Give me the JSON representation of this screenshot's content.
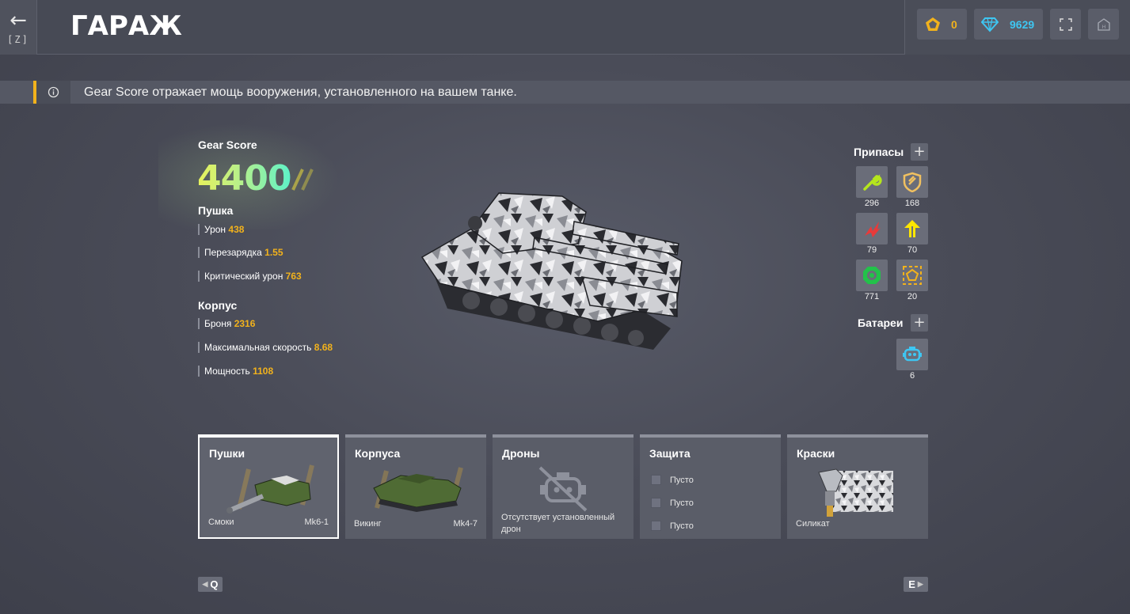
{
  "header": {
    "back_arrow": "←",
    "back_key": "[Z]",
    "title": "ГАРАЖ",
    "gold_crystals": "0",
    "crystals": "9629",
    "icons": [
      "back-arrow-icon",
      "pentagon-crystal-icon",
      "diamond-icon",
      "fullscreen-icon",
      "home-icon"
    ]
  },
  "info": {
    "icon": "info-icon",
    "text": "Gear Score отражает мощь вооружения, установленного на вашем танке."
  },
  "gear_score": {
    "label": "Gear Score",
    "value": "4400"
  },
  "turret": {
    "title": "Пушка",
    "stats": [
      {
        "label": "Урон",
        "value": "438"
      },
      {
        "label": "Перезарядка",
        "value": "1.55"
      },
      {
        "label": "Критический урон",
        "value": "763"
      }
    ]
  },
  "hull": {
    "title": "Корпус",
    "stats": [
      {
        "label": "Броня",
        "value": "2316"
      },
      {
        "label": "Максимальная скорость",
        "value": "8.68"
      },
      {
        "label": "Мощность",
        "value": "1108"
      }
    ]
  },
  "supplies": {
    "title": "Припасы",
    "plus": "+",
    "items": [
      {
        "icon": "repair-wrench-icon",
        "count": "296",
        "color": "#b5e61d"
      },
      {
        "icon": "armor-shield-icon",
        "count": "168",
        "color": "#f0c060"
      },
      {
        "icon": "double-damage-icon",
        "count": "79",
        "color": "#e83a3a"
      },
      {
        "icon": "speed-boost-icon",
        "count": "70",
        "color": "#ffe600"
      },
      {
        "icon": "mine-icon",
        "count": "771",
        "color": "#22c24a"
      },
      {
        "icon": "gold-box-icon",
        "count": "20",
        "color": "#f2b21c"
      }
    ]
  },
  "batteries": {
    "title": "Батареи",
    "plus": "+",
    "items": [
      {
        "icon": "battery-robot-icon",
        "count": "6",
        "color": "#3ec6f2"
      }
    ]
  },
  "cards": {
    "turrets": {
      "title": "Пушки",
      "name": "Смоки",
      "mod": "Mk6-1"
    },
    "hulls": {
      "title": "Корпуса",
      "name": "Викинг",
      "mod": "Mk4-7"
    },
    "drones": {
      "title": "Дроны",
      "note": "Отсутствует установленный дрон"
    },
    "protection": {
      "title": "Защита",
      "slots": [
        "Пусто",
        "Пусто",
        "Пусто"
      ]
    },
    "paints": {
      "title": "Краски",
      "name": "Силикат"
    }
  },
  "nav": {
    "prev_key": "Q",
    "next_key": "E",
    "prev_arrow": "◀",
    "next_arrow": "▶"
  },
  "colors": {
    "accent": "#f2b21c",
    "crystal_blue": "#3ec6f2",
    "gs_gradient": [
      "#e8f25c",
      "#5ef2c8"
    ]
  }
}
